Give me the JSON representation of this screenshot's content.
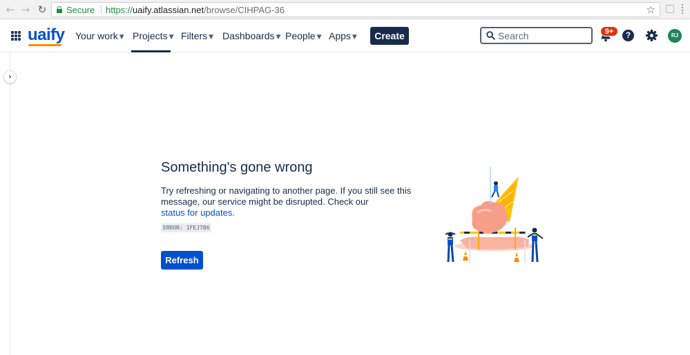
{
  "browser": {
    "back_icon": "arrow-left-icon",
    "forward_icon": "arrow-right-icon",
    "reload_icon": "reload-icon",
    "secure_label": "Secure",
    "url_scheme": "https://",
    "url_host": "uaify.atlassian.net",
    "url_path": "/browse/CIHPAG-36",
    "bookmark_icon": "star-icon"
  },
  "header": {
    "logo_text": "uaify",
    "menu": [
      {
        "label": "Your work"
      },
      {
        "label": "Projects"
      },
      {
        "label": "Filters"
      },
      {
        "label": "Dashboards"
      },
      {
        "label": "People"
      },
      {
        "label": "Apps"
      }
    ],
    "active_menu": "Projects",
    "create_label": "Create",
    "search_placeholder": "Search",
    "notifications_badge": "9+",
    "help_glyph": "?",
    "avatar_initials": "RJ"
  },
  "error": {
    "title": "Something's gone wrong",
    "message_line1": "Try refreshing or navigating to another page. If you still see this",
    "message_line2": "message, our service might be disrupted. Check our",
    "status_link": "status for updates.",
    "code": "ERROR: 1FEJ786",
    "refresh_label": "Refresh"
  },
  "colors": {
    "brand": "#0052cc",
    "primary_text": "#172b4d",
    "secure_green": "#1e8e3e",
    "badge_red": "#de350b",
    "avatar_green": "#1f845a",
    "logo_accent": "#ff8b00"
  }
}
